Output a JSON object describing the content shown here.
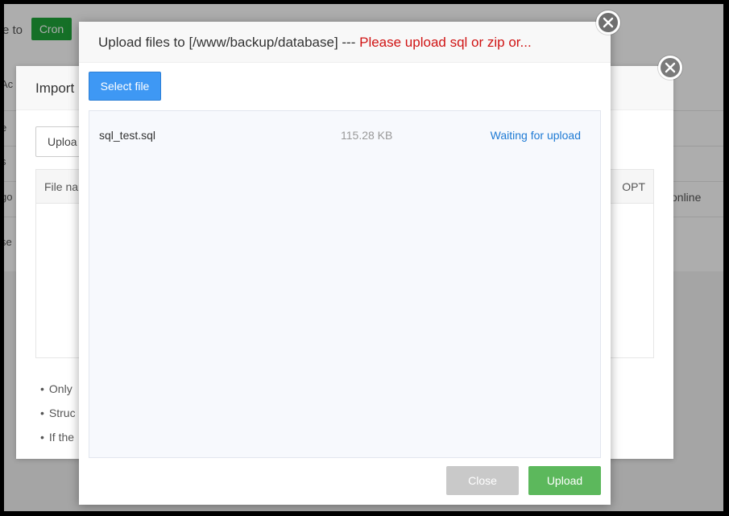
{
  "background": {
    "go_text": "e to",
    "cron_button": "Cron",
    "side_labels": [
      "Ac",
      "e",
      "s",
      "go",
      "se"
    ],
    "online_label": "online"
  },
  "import_dialog": {
    "title": "Import",
    "upload_button": "Uploa",
    "table": {
      "col_name": "File nar",
      "col_opt": "OPT"
    },
    "notes": [
      "Only",
      "Struc",
      "If the"
    ]
  },
  "upload_dialog": {
    "title_prefix": "Upload files to [/www/backup/database] --- ",
    "title_warning": "Please upload sql or zip or...",
    "select_file_button": "Select file",
    "files": [
      {
        "name": "sql_test.sql",
        "size": "115.28 KB",
        "status": "Waiting for upload"
      }
    ],
    "close_button": "Close",
    "upload_button": "Upload"
  },
  "colors": {
    "warning": "#d01414",
    "select_btn": "#3e98f4",
    "upload_btn": "#5cb85c",
    "close_btn": "#c9c9c9",
    "status_link": "#1e7ad4",
    "cron_btn": "#20a53a"
  },
  "icons": [
    "close-icon"
  ]
}
